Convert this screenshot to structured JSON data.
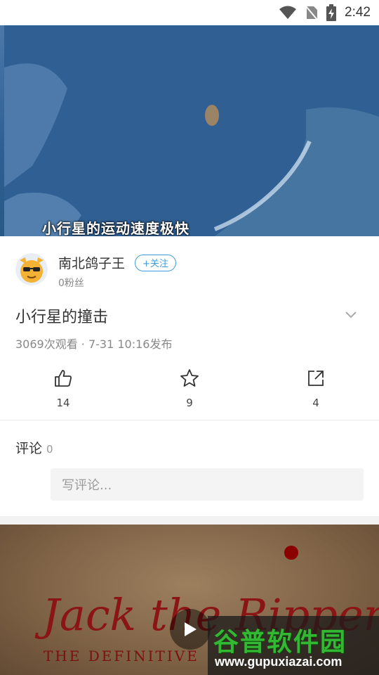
{
  "status_bar": {
    "time": "2:42",
    "icons": [
      "wifi-icon",
      "no-sim-icon",
      "battery-charging-icon"
    ]
  },
  "video": {
    "subtitle": "小行星的运动速度极快"
  },
  "author": {
    "name": "南北鸽子王",
    "follow_label": "+关注",
    "fans": "0粉丝"
  },
  "video_info": {
    "title": "小行星的撞击",
    "meta": "3069次观看 · 7-31 10:16发布"
  },
  "actions": [
    {
      "icon": "thumbs-up-icon",
      "count": "14"
    },
    {
      "icon": "star-icon",
      "count": "9"
    },
    {
      "icon": "share-icon",
      "count": "4"
    }
  ],
  "comments": {
    "title": "评论",
    "count": "0",
    "placeholder": "写评论..."
  },
  "next_video": {
    "title_art": "Jack the Ripper",
    "subtitle_art": "THE DEFINITIVE"
  },
  "watermark": {
    "brand": "谷普软件园",
    "url": "www.gupuxiazai.com"
  },
  "colors": {
    "accent": "#3e9cd8",
    "watermark_green": "#32b832"
  }
}
